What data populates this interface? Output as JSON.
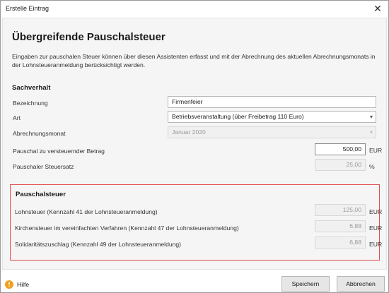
{
  "window": {
    "title": "Erstelle Eintrag"
  },
  "header": {
    "title": "Übergreifende Pauschalsteuer",
    "intro": "Eingaben zur pauschalen Steuer können über diesen Assistenten erfasst und mit der Abrechnung des aktuellen Abrechnungsmonats in der Lohnsteueranmeldung berücksichtigt werden."
  },
  "sachverhalt": {
    "title": "Sachverhalt",
    "bezeichnung": {
      "label": "Bezeichnung",
      "value": "Firmenfeier"
    },
    "art": {
      "label": "Art",
      "value": "Betriebsveranstaltung (über Freibetrag 110 Euro)"
    },
    "abrechnungsmonat": {
      "label": "Abrechnungsmonat",
      "value": "Januar 2020"
    },
    "betrag": {
      "label": "Pauschal zu versteuernder Betrag",
      "value": "500,00",
      "unit": "EUR"
    },
    "steuersatz": {
      "label": "Pauschaler Steuersatz",
      "value": "25,00",
      "unit": "%"
    }
  },
  "pauschalsteuer": {
    "title": "Pauschalsteuer",
    "rows": [
      {
        "label": "Lohnsteuer (Kennzahl 41 der Lohnsteueranmeldung)",
        "value": "125,00",
        "unit": "EUR"
      },
      {
        "label": "Kirchensteuer im vereinfachten Verfahren (Kennzahl 47 der Lohnsteueranmeldung)",
        "value": "6,88",
        "unit": "EUR"
      },
      {
        "label": "Solidaritätszuschlag (Kennzahl 49 der Lohnsteueranmeldung)",
        "value": "6,88",
        "unit": "EUR"
      }
    ]
  },
  "footer": {
    "help_label": "Hilfe",
    "save_label": "Speichern",
    "cancel_label": "Abbrechen"
  },
  "icons": {
    "close": "close-icon",
    "help": "help-icon",
    "dropdown": "chevron-down-icon"
  },
  "colors": {
    "group_border": "#e05050",
    "help_icon": "#f0a020"
  }
}
